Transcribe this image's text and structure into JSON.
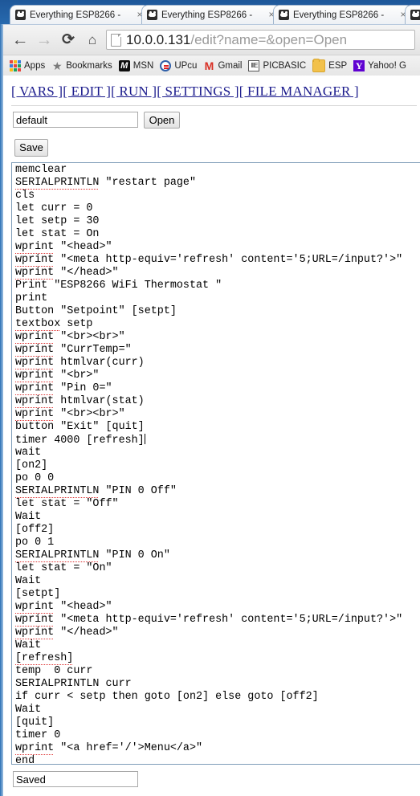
{
  "browser": {
    "tabs": [
      {
        "title": "Everything ESP8266 -",
        "favicon": "esp-favicon",
        "close": "×"
      },
      {
        "title": "Everything ESP8266 -",
        "favicon": "esp-favicon",
        "close": "×"
      },
      {
        "title": "Everything ESP8266 -",
        "favicon": "esp-favicon",
        "close": "×"
      },
      {
        "title": "",
        "favicon": "esp-favicon",
        "close": ""
      }
    ],
    "nav": {
      "back": "←",
      "forward": "→",
      "reload": "⟳",
      "home": "⌂"
    },
    "omnibox": {
      "host": "10.0.0.131",
      "path": "/edit?name=&open=Open",
      "full_url": "10.0.0.131/edit?name=&open=Open"
    },
    "bookmarks": [
      {
        "label": "Apps",
        "icon": "apps-grid-icon"
      },
      {
        "label": "Bookmarks",
        "icon": "star-icon"
      },
      {
        "label": "MSN",
        "icon": "msn-icon"
      },
      {
        "label": "UPcu",
        "icon": "upcu-icon"
      },
      {
        "label": "Gmail",
        "icon": "gmail-icon"
      },
      {
        "label": "PICBASIC",
        "icon": "picbasic-icon"
      },
      {
        "label": "ESP",
        "icon": "folder-icon"
      },
      {
        "label": "Yahoo! G",
        "icon": "yahoo-icon"
      }
    ]
  },
  "page": {
    "navlinks": [
      {
        "label": "[ VARS ]"
      },
      {
        "label": "[ EDIT ]"
      },
      {
        "label": "[ RUN ]"
      },
      {
        "label": "[ SETTINGS ]"
      },
      {
        "label": "[ FILE MANAGER ]"
      }
    ],
    "filename_value": "default",
    "filename_placeholder": "",
    "open_label": "Open",
    "save_label": "Save",
    "status_value": "Saved",
    "code_lines": [
      {
        "text": "memclear",
        "misspelled": false
      },
      {
        "text": "SERIALPRINTLN \"restart page\"",
        "misspelled": true
      },
      {
        "text": "cls",
        "misspelled": false
      },
      {
        "text": "let curr = 0",
        "misspelled": false
      },
      {
        "text": "let setp = 30",
        "misspelled": false
      },
      {
        "text": "let stat = On",
        "misspelled": false
      },
      {
        "text": "wprint \"<head>\"",
        "misspelled": true
      },
      {
        "text": "wprint \"<meta http-equiv='refresh' content='5;URL=/input?'>\"",
        "misspelled": true
      },
      {
        "text": "wprint \"</head>\"",
        "misspelled": true
      },
      {
        "text": "Print \"ESP8266 WiFi Thermostat \"",
        "misspelled": false
      },
      {
        "text": "print",
        "misspelled": false
      },
      {
        "text": "Button \"Setpoint\" [setpt]",
        "misspelled": false
      },
      {
        "text": "textbox setp",
        "misspelled": true
      },
      {
        "text": "wprint \"<br><br>\"",
        "misspelled": true
      },
      {
        "text": "wprint \"CurrTemp=\"",
        "misspelled": true
      },
      {
        "text": "wprint htmlvar(curr)",
        "misspelled": true
      },
      {
        "text": "wprint \"<br>\"",
        "misspelled": true
      },
      {
        "text": "wprint \"Pin 0=\"",
        "misspelled": true
      },
      {
        "text": "wprint htmlvar(stat)",
        "misspelled": true
      },
      {
        "text": "wprint \"<br><br>\"",
        "misspelled": true
      },
      {
        "text": "button \"Exit\" [quit]",
        "misspelled": false
      },
      {
        "text": "timer 4000 [refresh]",
        "misspelled": false,
        "caret": true
      },
      {
        "text": "wait",
        "misspelled": false
      },
      {
        "text": "[on2]",
        "misspelled": false
      },
      {
        "text": "po 0 0",
        "misspelled": false
      },
      {
        "text": "SERIALPRINTLN \"PIN 0 Off\"",
        "misspelled": true
      },
      {
        "text": "let stat = \"Off\"",
        "misspelled": false
      },
      {
        "text": "Wait",
        "misspelled": false
      },
      {
        "text": "[off2]",
        "misspelled": false
      },
      {
        "text": "po 0 1",
        "misspelled": false
      },
      {
        "text": "SERIALPRINTLN \"PIN 0 On\"",
        "misspelled": true
      },
      {
        "text": "let stat = \"On\"",
        "misspelled": false
      },
      {
        "text": "Wait",
        "misspelled": false
      },
      {
        "text": "[setpt]",
        "misspelled": false
      },
      {
        "text": "wprint \"<head>\"",
        "misspelled": true
      },
      {
        "text": "wprint \"<meta http-equiv='refresh' content='5;URL=/input?'>\"",
        "misspelled": true
      },
      {
        "text": "wprint \"</head>\"",
        "misspelled": true
      },
      {
        "text": "Wait",
        "misspelled": false
      },
      {
        "text": "[refresh]",
        "misspelled": true
      },
      {
        "text": "temp  0 curr",
        "misspelled": false
      },
      {
        "text": "SERIALPRINTLN curr",
        "misspelled": false
      },
      {
        "text": "if curr < setp then goto [on2] else goto [off2]",
        "misspelled": false
      },
      {
        "text": "Wait",
        "misspelled": false
      },
      {
        "text": "[quit]",
        "misspelled": false
      },
      {
        "text": "timer 0",
        "misspelled": false
      },
      {
        "text": "wprint \"<a href='/'>Menu</a>\"",
        "misspelled": true
      },
      {
        "text": "end",
        "misspelled": false
      }
    ]
  },
  "colors": {
    "chrome_blue": "#2a6fb5",
    "link_blue": "#1a1a8c",
    "editor_border": "#7f9db9",
    "spellcheck_red": "#dd3333"
  }
}
